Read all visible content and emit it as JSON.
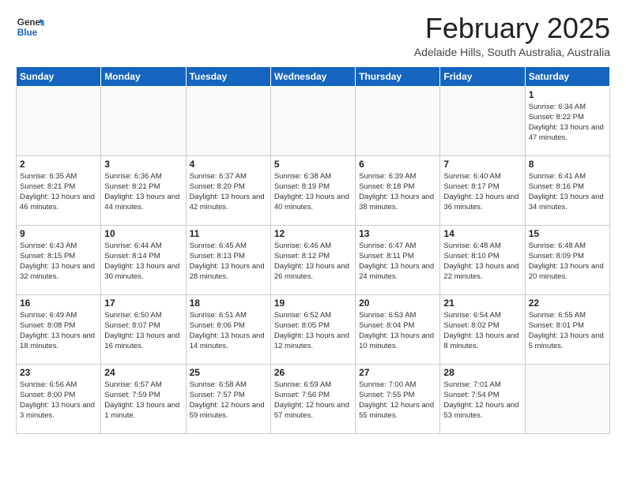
{
  "header": {
    "logo_general": "General",
    "logo_blue": "Blue",
    "month_title": "February 2025",
    "location": "Adelaide Hills, South Australia, Australia"
  },
  "days_of_week": [
    "Sunday",
    "Monday",
    "Tuesday",
    "Wednesday",
    "Thursday",
    "Friday",
    "Saturday"
  ],
  "weeks": [
    [
      {
        "day": "",
        "info": ""
      },
      {
        "day": "",
        "info": ""
      },
      {
        "day": "",
        "info": ""
      },
      {
        "day": "",
        "info": ""
      },
      {
        "day": "",
        "info": ""
      },
      {
        "day": "",
        "info": ""
      },
      {
        "day": "1",
        "info": "Sunrise: 6:34 AM\nSunset: 8:22 PM\nDaylight: 13 hours and 47 minutes."
      }
    ],
    [
      {
        "day": "2",
        "info": "Sunrise: 6:35 AM\nSunset: 8:21 PM\nDaylight: 13 hours and 46 minutes."
      },
      {
        "day": "3",
        "info": "Sunrise: 6:36 AM\nSunset: 8:21 PM\nDaylight: 13 hours and 44 minutes."
      },
      {
        "day": "4",
        "info": "Sunrise: 6:37 AM\nSunset: 8:20 PM\nDaylight: 13 hours and 42 minutes."
      },
      {
        "day": "5",
        "info": "Sunrise: 6:38 AM\nSunset: 8:19 PM\nDaylight: 13 hours and 40 minutes."
      },
      {
        "day": "6",
        "info": "Sunrise: 6:39 AM\nSunset: 8:18 PM\nDaylight: 13 hours and 38 minutes."
      },
      {
        "day": "7",
        "info": "Sunrise: 6:40 AM\nSunset: 8:17 PM\nDaylight: 13 hours and 36 minutes."
      },
      {
        "day": "8",
        "info": "Sunrise: 6:41 AM\nSunset: 8:16 PM\nDaylight: 13 hours and 34 minutes."
      }
    ],
    [
      {
        "day": "9",
        "info": "Sunrise: 6:43 AM\nSunset: 8:15 PM\nDaylight: 13 hours and 32 minutes."
      },
      {
        "day": "10",
        "info": "Sunrise: 6:44 AM\nSunset: 8:14 PM\nDaylight: 13 hours and 30 minutes."
      },
      {
        "day": "11",
        "info": "Sunrise: 6:45 AM\nSunset: 8:13 PM\nDaylight: 13 hours and 28 minutes."
      },
      {
        "day": "12",
        "info": "Sunrise: 6:46 AM\nSunset: 8:12 PM\nDaylight: 13 hours and 26 minutes."
      },
      {
        "day": "13",
        "info": "Sunrise: 6:47 AM\nSunset: 8:11 PM\nDaylight: 13 hours and 24 minutes."
      },
      {
        "day": "14",
        "info": "Sunrise: 6:48 AM\nSunset: 8:10 PM\nDaylight: 13 hours and 22 minutes."
      },
      {
        "day": "15",
        "info": "Sunrise: 6:48 AM\nSunset: 8:09 PM\nDaylight: 13 hours and 20 minutes."
      }
    ],
    [
      {
        "day": "16",
        "info": "Sunrise: 6:49 AM\nSunset: 8:08 PM\nDaylight: 13 hours and 18 minutes."
      },
      {
        "day": "17",
        "info": "Sunrise: 6:50 AM\nSunset: 8:07 PM\nDaylight: 13 hours and 16 minutes."
      },
      {
        "day": "18",
        "info": "Sunrise: 6:51 AM\nSunset: 8:06 PM\nDaylight: 13 hours and 14 minutes."
      },
      {
        "day": "19",
        "info": "Sunrise: 6:52 AM\nSunset: 8:05 PM\nDaylight: 13 hours and 12 minutes."
      },
      {
        "day": "20",
        "info": "Sunrise: 6:53 AM\nSunset: 8:04 PM\nDaylight: 13 hours and 10 minutes."
      },
      {
        "day": "21",
        "info": "Sunrise: 6:54 AM\nSunset: 8:02 PM\nDaylight: 13 hours and 8 minutes."
      },
      {
        "day": "22",
        "info": "Sunrise: 6:55 AM\nSunset: 8:01 PM\nDaylight: 13 hours and 5 minutes."
      }
    ],
    [
      {
        "day": "23",
        "info": "Sunrise: 6:56 AM\nSunset: 8:00 PM\nDaylight: 13 hours and 3 minutes."
      },
      {
        "day": "24",
        "info": "Sunrise: 6:57 AM\nSunset: 7:59 PM\nDaylight: 13 hours and 1 minute."
      },
      {
        "day": "25",
        "info": "Sunrise: 6:58 AM\nSunset: 7:57 PM\nDaylight: 12 hours and 59 minutes."
      },
      {
        "day": "26",
        "info": "Sunrise: 6:59 AM\nSunset: 7:56 PM\nDaylight: 12 hours and 57 minutes."
      },
      {
        "day": "27",
        "info": "Sunrise: 7:00 AM\nSunset: 7:55 PM\nDaylight: 12 hours and 55 minutes."
      },
      {
        "day": "28",
        "info": "Sunrise: 7:01 AM\nSunset: 7:54 PM\nDaylight: 12 hours and 53 minutes."
      },
      {
        "day": "",
        "info": ""
      }
    ]
  ]
}
